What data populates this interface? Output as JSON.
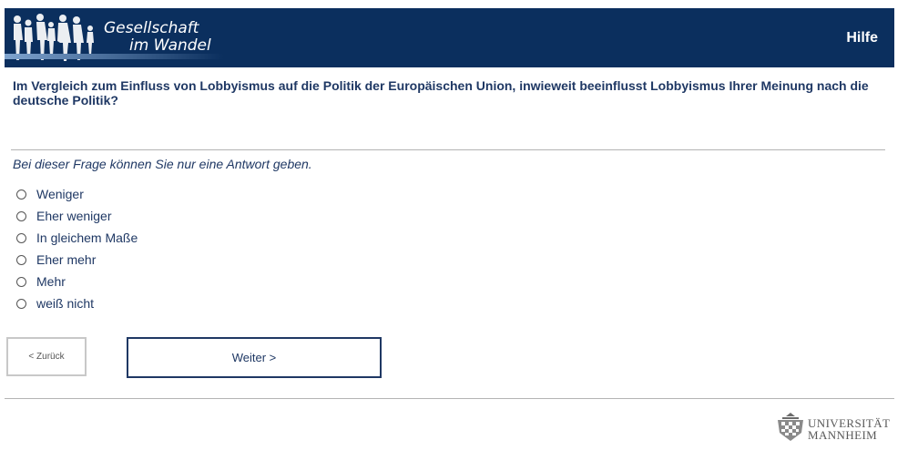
{
  "header": {
    "logo_line1": "Gesellschaft",
    "logo_line2": "im Wandel",
    "help_label": "Hilfe"
  },
  "question": {
    "text": "Im Vergleich zum Einfluss von Lobbyismus auf die Politik der Europäischen Union, inwieweit beeinflusst Lobbyismus Ihrer Meinung nach die deutsche Politik?",
    "hint": "Bei dieser Frage können Sie nur eine Antwort geben."
  },
  "options": [
    {
      "label": "Weniger"
    },
    {
      "label": "Eher weniger"
    },
    {
      "label": "In gleichem Maße"
    },
    {
      "label": "Eher mehr"
    },
    {
      "label": "Mehr"
    },
    {
      "label": "weiß nicht"
    }
  ],
  "nav": {
    "back_label": "< Zurück",
    "next_label": "Weiter >"
  },
  "footer": {
    "logo_line1": "UNIVERSITÄT",
    "logo_line2": "MANNHEIM"
  },
  "colors": {
    "header_bg": "#0b2f5e",
    "text": "#1f3864"
  }
}
